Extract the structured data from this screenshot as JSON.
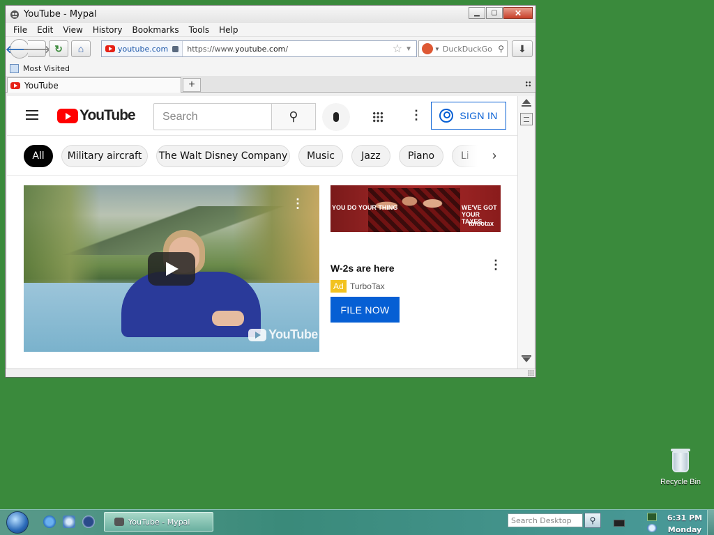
{
  "window": {
    "title": "YouTube - Mypal",
    "minimize_symbol": "▁",
    "maximize_symbol": "▢",
    "close_symbol": "✕"
  },
  "menu": [
    "File",
    "Edit",
    "View",
    "History",
    "Bookmarks",
    "Tools",
    "Help"
  ],
  "navigation": {
    "identity_host": "youtube.com",
    "url_prefix": "https://www.",
    "url_domain": "youtube.com",
    "url_suffix": "/",
    "search_engine": "DuckDuckGo"
  },
  "bookmarks": {
    "most_visited": "Most Visited"
  },
  "tabs": [
    {
      "label": "YouTube"
    }
  ],
  "youtube": {
    "logo_text": "YouTube",
    "search_placeholder": "Search",
    "sign_in": "SIGN IN",
    "chips": [
      "All",
      "Military aircraft",
      "The Walt Disney Company",
      "Music",
      "Jazz",
      "Piano",
      "Li"
    ],
    "active_chip": "All",
    "video_watermark": "YouTube",
    "ad": {
      "banner_left": "YOU DO YOUR THING",
      "banner_right": "WE'VE GOT YOUR TAXES",
      "banner_brand": "turbotax",
      "title": "W-2s are here",
      "badge": "Ad",
      "advertiser": "TurboTax",
      "cta": "FILE NOW"
    }
  },
  "desktop": {
    "recycle_bin": "Recycle Bin"
  },
  "taskbar": {
    "window_button": "YouTube - Mypal",
    "search_placeholder": "Search Desktop",
    "time": "6:31 PM",
    "day": "Monday"
  }
}
